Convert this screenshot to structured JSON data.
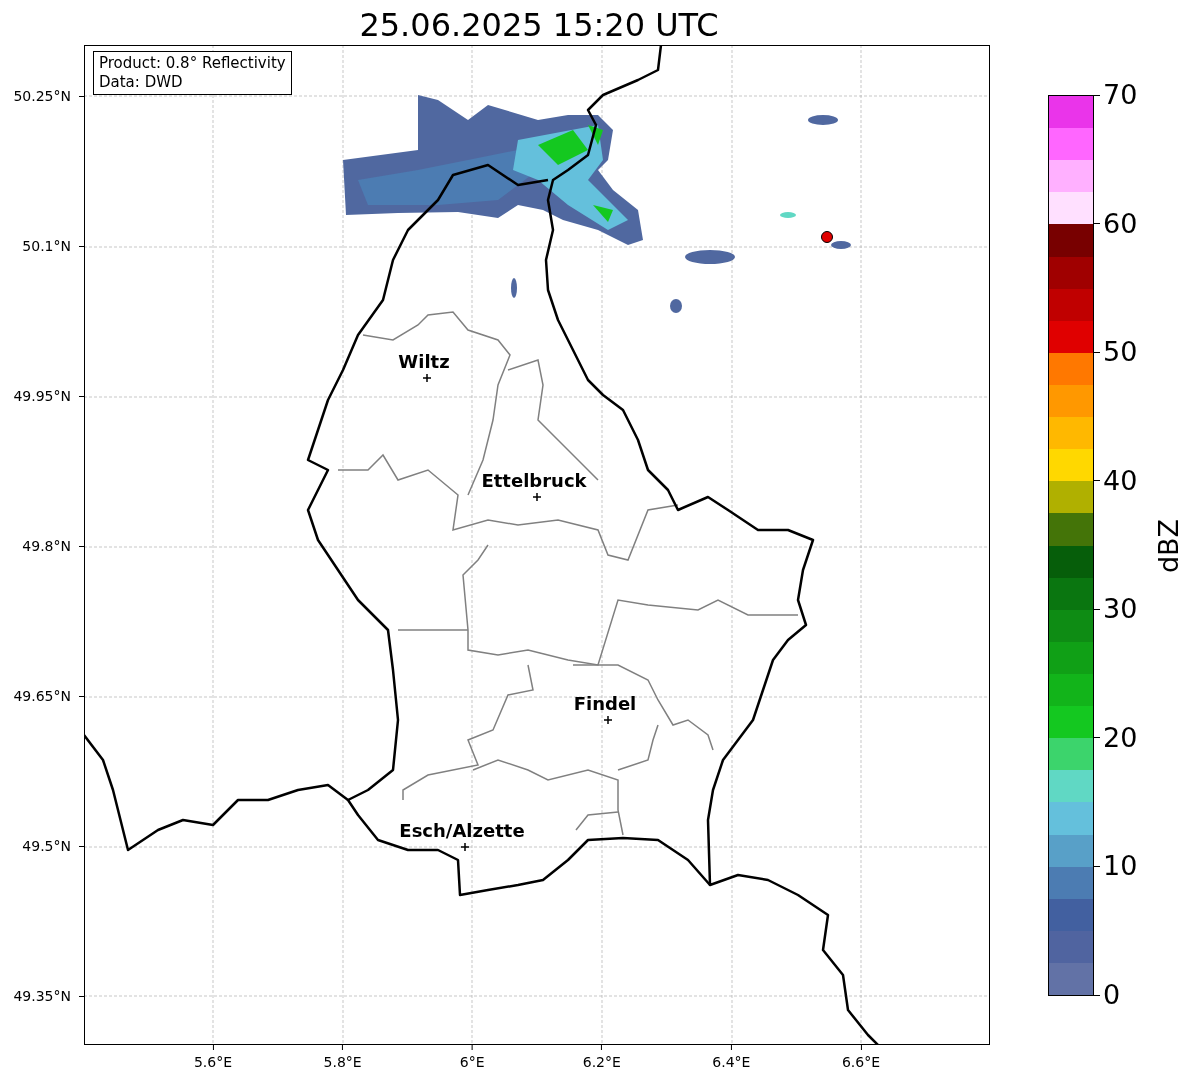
{
  "title": "25.06.2025 15:20 UTC",
  "info_box": [
    "Product: 0.8° Reflectivity",
    "Data: DWD"
  ],
  "map": {
    "lat_ticks": [
      "50.25°N",
      "50.1°N",
      "49.95°N",
      "49.8°N",
      "49.65°N",
      "49.5°N",
      "49.35°N"
    ],
    "lon_ticks": [
      "5.6°E",
      "5.8°E",
      "6°E",
      "6.2°E",
      "6.4°E",
      "6.6°E"
    ],
    "cities": [
      {
        "name": "Wiltz"
      },
      {
        "name": "Ettelbruck"
      },
      {
        "name": "Findel"
      },
      {
        "name": "Esch/Alzette"
      }
    ]
  },
  "colorbar": {
    "label": "dBZ",
    "ticks": [
      "70",
      "60",
      "50",
      "40",
      "30",
      "20",
      "10",
      "0"
    ],
    "bins": [
      {
        "color": "#ea34ea"
      },
      {
        "color": "#ff66ff"
      },
      {
        "color": "#ffb0ff"
      },
      {
        "color": "#ffe0ff"
      },
      {
        "color": "#780000"
      },
      {
        "color": "#a00000"
      },
      {
        "color": "#c00000"
      },
      {
        "color": "#e00000"
      },
      {
        "color": "#ff7800"
      },
      {
        "color": "#ff9800"
      },
      {
        "color": "#ffb800"
      },
      {
        "color": "#ffd800"
      },
      {
        "color": "#b0b000"
      },
      {
        "color": "#447408"
      },
      {
        "color": "#065e0a"
      },
      {
        "color": "#0a7610"
      },
      {
        "color": "#0e8c14"
      },
      {
        "color": "#10a016"
      },
      {
        "color": "#12b41a"
      },
      {
        "color": "#14c820"
      },
      {
        "color": "#3cd46c"
      },
      {
        "color": "#60d8c4"
      },
      {
        "color": "#64c0dc"
      },
      {
        "color": "#58a0c8"
      },
      {
        "color": "#4c7cb2"
      },
      {
        "color": "#4260a0"
      },
      {
        "color": "#5064a0"
      },
      {
        "color": "#6272a6"
      }
    ]
  }
}
